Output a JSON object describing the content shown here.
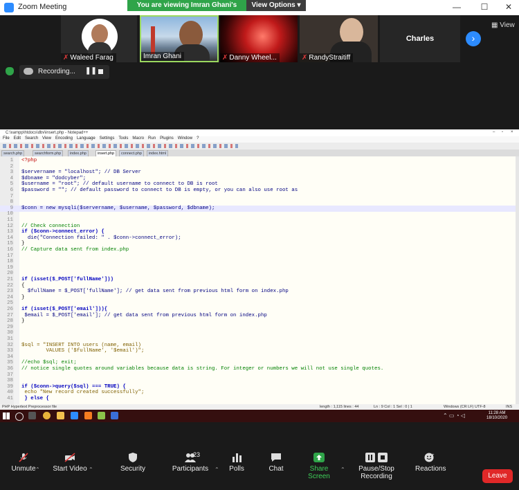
{
  "window": {
    "title": "Zoom Meeting"
  },
  "share_banner": {
    "text": "You are viewing Imran Ghani's screen",
    "view_options": "View Options"
  },
  "participants": [
    {
      "name": "Waleed Farag",
      "muted": true
    },
    {
      "name": "Imran Ghani",
      "muted": false
    },
    {
      "name": "Danny Wheel...",
      "muted": true
    },
    {
      "name": "RandyStraitiff",
      "muted": true
    },
    {
      "name": "Charles",
      "muted": false
    }
  ],
  "view_button": "View",
  "recording": {
    "label": "Recording..."
  },
  "notepad": {
    "title": "C:\\xampp\\htdocs\\dbv\\insert.php - Notepad++",
    "menu": [
      "File",
      "Edit",
      "Search",
      "View",
      "Encoding",
      "Language",
      "Settings",
      "Tools",
      "Macro",
      "Run",
      "Plugins",
      "Window",
      "?"
    ],
    "tabs": [
      "search.php",
      "searchform.php",
      "index.php",
      "insert.php",
      "connect.php",
      "index.html"
    ],
    "active_tab": "insert.php",
    "lines": [
      {
        "n": "1",
        "t": "<?php",
        "k": "tag"
      },
      {
        "n": "2",
        "t": "",
        "k": "plain"
      },
      {
        "n": "3",
        "t": "$servername = \"localhost\"; // DB Server",
        "k": "mix"
      },
      {
        "n": "4",
        "t": "$dbname = \"dodcyber\";",
        "k": "mix"
      },
      {
        "n": "5",
        "t": "$username = \"root\"; // default username to connect to DB is root",
        "k": "mix"
      },
      {
        "n": "6",
        "t": "$password = \"\"; // default password to connect to DB is empty, or you can also use root as",
        "k": "mix"
      },
      {
        "n": "7",
        "t": "",
        "k": "plain"
      },
      {
        "n": "8",
        "t": "",
        "k": "plain"
      },
      {
        "n": "9",
        "t": "$conn = new mysqli($servername, $username, $password, $dbname);",
        "k": "var",
        "hl": true
      },
      {
        "n": "10",
        "t": "",
        "k": "plain"
      },
      {
        "n": "11",
        "t": "",
        "k": "plain"
      },
      {
        "n": "12",
        "t": "// Check connection",
        "k": "cmt"
      },
      {
        "n": "13",
        "t": "if ($conn->connect_error) {",
        "k": "kw"
      },
      {
        "n": "14",
        "t": "  die(\"Connection failed: \" . $conn->connect_error);",
        "k": "var"
      },
      {
        "n": "15",
        "t": "}",
        "k": "plain"
      },
      {
        "n": "16",
        "t": "// Capture data sent from index.php",
        "k": "cmt"
      },
      {
        "n": "17",
        "t": "",
        "k": "plain"
      },
      {
        "n": "18",
        "t": "",
        "k": "plain"
      },
      {
        "n": "19",
        "t": "",
        "k": "plain"
      },
      {
        "n": "20",
        "t": "",
        "k": "plain"
      },
      {
        "n": "21",
        "t": "if (isset($_POST['fullName']))",
        "k": "kw"
      },
      {
        "n": "22",
        "t": "{",
        "k": "plain"
      },
      {
        "n": "23",
        "t": "  $fullName = $_POST['fullName']; // get data sent from previous html form on index.php",
        "k": "mix"
      },
      {
        "n": "24",
        "t": "}",
        "k": "plain"
      },
      {
        "n": "25",
        "t": "",
        "k": "plain"
      },
      {
        "n": "26",
        "t": "if (isset($_POST['email'])){",
        "k": "kw"
      },
      {
        "n": "27",
        "t": " $email = $_POST['email']; // get data sent from previous html form on index.php",
        "k": "mix"
      },
      {
        "n": "28",
        "t": "}",
        "k": "plain"
      },
      {
        "n": "29",
        "t": "",
        "k": "plain"
      },
      {
        "n": "30",
        "t": "",
        "k": "plain"
      },
      {
        "n": "31",
        "t": "",
        "k": "plain"
      },
      {
        "n": "32",
        "t": "$sql = \"INSERT INTO users (name, email)",
        "k": "str"
      },
      {
        "n": "33",
        "t": "        VALUES ('$fullName', '$email')\";",
        "k": "str"
      },
      {
        "n": "34",
        "t": "",
        "k": "plain"
      },
      {
        "n": "35",
        "t": "//echo $sql; exit;",
        "k": "cmt"
      },
      {
        "n": "36",
        "t": "// notice single quotes around variables because data is string. For integer or numbers we will not use single quotes.",
        "k": "cmt"
      },
      {
        "n": "37",
        "t": "",
        "k": "plain"
      },
      {
        "n": "38",
        "t": "",
        "k": "plain"
      },
      {
        "n": "39",
        "t": "if ($conn->query($sql) === TRUE) {",
        "k": "kw"
      },
      {
        "n": "40",
        "t": " echo \"New record created successfully\";",
        "k": "str"
      },
      {
        "n": "41",
        "t": " } else {",
        "k": "kw"
      }
    ],
    "status_left": "PHP Hypertext Preprocessor file",
    "status_length": "length : 1,115   lines : 44",
    "status_pos": "Ln : 9    Col : 1    Sel : 0 | 1",
    "status_eol": "Windows (CR LF)",
    "status_enc": "UTF-8",
    "status_ins": "INS"
  },
  "taskbar": {
    "time": "11:28 AM",
    "date": "18/10/2020"
  },
  "toolbar": {
    "unmute": "Unmute",
    "start_video": "Start Video",
    "security": "Security",
    "participants": "Participants",
    "participants_count": "23",
    "polls": "Polls",
    "chat": "Chat",
    "share_screen": "Share Screen",
    "pause_recording": "Pause/Stop Recording",
    "reactions": "Reactions",
    "leave": "Leave"
  },
  "colors": {
    "share_green": "#2fa449",
    "zoom_blue": "#2d8cff",
    "leave_red": "#e02828"
  }
}
